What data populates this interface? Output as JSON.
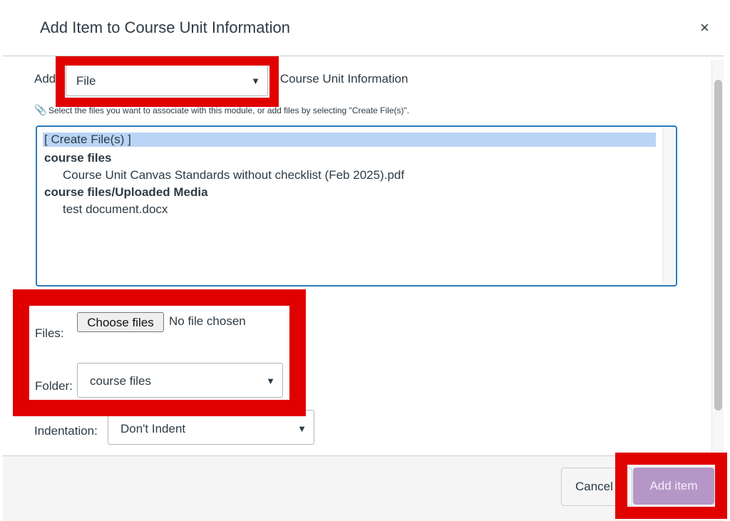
{
  "dialog": {
    "title": "Add Item to Course Unit Information",
    "close_symbol": "×"
  },
  "add_row": {
    "prefix": "Add",
    "item_type": "File",
    "suffix": "to Course Unit Information"
  },
  "hint_text": "Select the files you want to associate with this module, or add files by selecting \"Create File(s)\".",
  "file_list": {
    "options": [
      "[ Create File(s) ]",
      "course files",
      "Course Unit Canvas Standards without checklist (Feb 2025).pdf",
      "course files/Uploaded Media",
      "test document.docx"
    ]
  },
  "files": {
    "label": "Files:",
    "button": "Choose files",
    "status": "No file chosen"
  },
  "folder": {
    "label": "Folder:",
    "value": "course files"
  },
  "indentation": {
    "label": "Indentation:",
    "value": "Don't Indent"
  },
  "footer": {
    "cancel": "Cancel",
    "add": "Add item"
  },
  "colors": {
    "highlight": "#e00000",
    "primary_disabled": "#b497c6",
    "list_focus": "#2b7abc",
    "selected_option": "#b9d4f5"
  }
}
